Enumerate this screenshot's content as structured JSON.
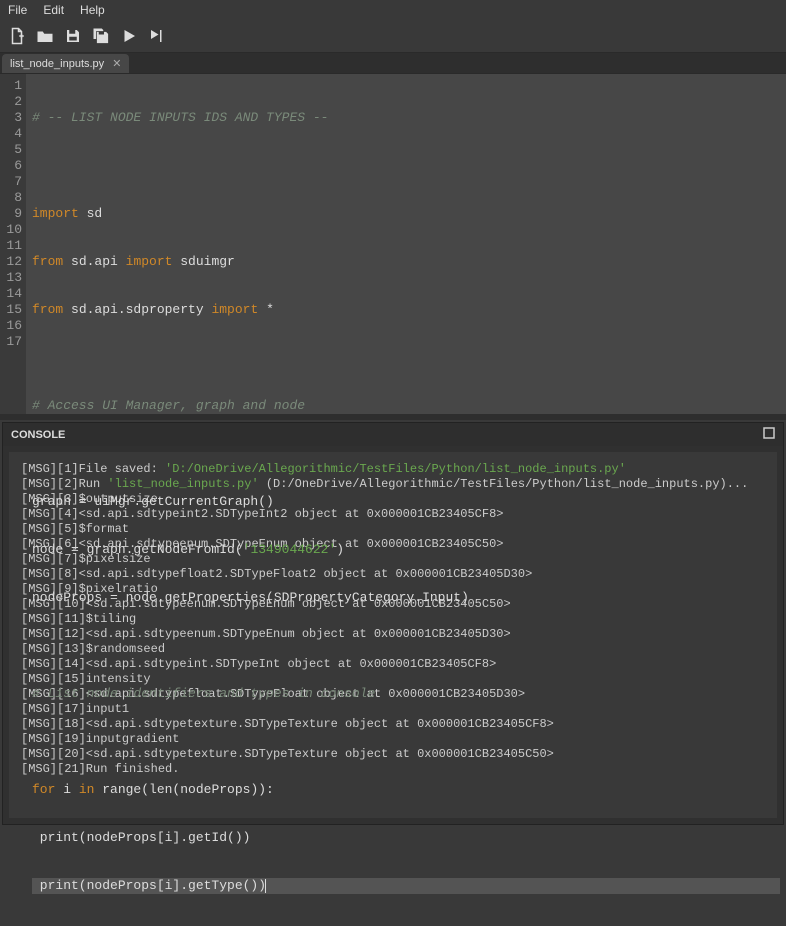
{
  "menubar": {
    "file": "File",
    "edit": "Edit",
    "help": "Help"
  },
  "tab": {
    "name": "list_node_inputs.py"
  },
  "gutter": [
    "1",
    "2",
    "3",
    "4",
    "5",
    "6",
    "7",
    "8",
    "9",
    "10",
    "11",
    "12",
    "13",
    "14",
    "15",
    "16",
    "17"
  ],
  "code": {
    "l1_a": "# -- LIST NODE INPUTS IDS AND TYPES --",
    "l3_a": "import",
    "l3_b": " sd",
    "l4_a": "from",
    "l4_b": " sd.api ",
    "l4_c": "import",
    "l4_d": " sduimgr",
    "l5_a": "from",
    "l5_b": " sd.api.sdproperty ",
    "l5_c": "import",
    "l5_d": " *",
    "l7_a": "# Access UI Manager, graph and node",
    "l9_a": "graph = uiMgr.getCurrentGraph()",
    "l10_a": "node = graph.getNodeFromId(",
    "l10_b": "'1349044622'",
    "l10_c": ")",
    "l11_a": "nodeProps = node.getProperties(SDPropertyCategory.Input)",
    "l13_a": "# List node identifiers and types in console",
    "l15_a": "for",
    "l15_b": " i ",
    "l15_c": "in",
    "l15_d": " range(len(nodeProps)):",
    "l16_a": " print(nodeProps[i].getId())",
    "l17_a": " print(nodeProps[i].getType())"
  },
  "console": {
    "title": "CONSOLE",
    "lines": [
      {
        "pre": "[MSG][1]File saved: ",
        "grn": "'D:/OneDrive/Allegorithmic/TestFiles/Python/list_node_inputs.py'",
        "post": ""
      },
      {
        "pre": "[MSG][2]Run ",
        "grn": "'list_node_inputs.py'",
        "post": " (D:/OneDrive/Allegorithmic/TestFiles/Python/list_node_inputs.py)..."
      },
      {
        "pre": "[MSG][3]$outputsize",
        "grn": "",
        "post": ""
      },
      {
        "pre": "[MSG][4]<sd.api.sdtypeint2.SDTypeInt2 object at 0x000001CB23405CF8>",
        "grn": "",
        "post": ""
      },
      {
        "pre": "[MSG][5]$format",
        "grn": "",
        "post": ""
      },
      {
        "pre": "[MSG][6]<sd.api.sdtypeenum.SDTypeEnum object at 0x000001CB23405C50>",
        "grn": "",
        "post": ""
      },
      {
        "pre": "[MSG][7]$pixelsize",
        "grn": "",
        "post": ""
      },
      {
        "pre": "[MSG][8]<sd.api.sdtypefloat2.SDTypeFloat2 object at 0x000001CB23405D30>",
        "grn": "",
        "post": ""
      },
      {
        "pre": "[MSG][9]$pixelratio",
        "grn": "",
        "post": ""
      },
      {
        "pre": "[MSG][10]<sd.api.sdtypeenum.SDTypeEnum object at 0x000001CB23405C50>",
        "grn": "",
        "post": ""
      },
      {
        "pre": "[MSG][11]$tiling",
        "grn": "",
        "post": ""
      },
      {
        "pre": "[MSG][12]<sd.api.sdtypeenum.SDTypeEnum object at 0x000001CB23405D30>",
        "grn": "",
        "post": ""
      },
      {
        "pre": "[MSG][13]$randomseed",
        "grn": "",
        "post": ""
      },
      {
        "pre": "[MSG][14]<sd.api.sdtypeint.SDTypeInt object at 0x000001CB23405CF8>",
        "grn": "",
        "post": ""
      },
      {
        "pre": "[MSG][15]intensity",
        "grn": "",
        "post": ""
      },
      {
        "pre": "[MSG][16]<sd.api.sdtypefloat.SDTypeFloat object at 0x000001CB23405D30>",
        "grn": "",
        "post": ""
      },
      {
        "pre": "[MSG][17]input1",
        "grn": "",
        "post": ""
      },
      {
        "pre": "[MSG][18]<sd.api.sdtypetexture.SDTypeTexture object at 0x000001CB23405CF8>",
        "grn": "",
        "post": ""
      },
      {
        "pre": "[MSG][19]inputgradient",
        "grn": "",
        "post": ""
      },
      {
        "pre": "[MSG][20]<sd.api.sdtypetexture.SDTypeTexture object at 0x000001CB23405C50>",
        "grn": "",
        "post": ""
      },
      {
        "pre": "[MSG][21]Run finished.",
        "grn": "",
        "post": ""
      }
    ]
  }
}
